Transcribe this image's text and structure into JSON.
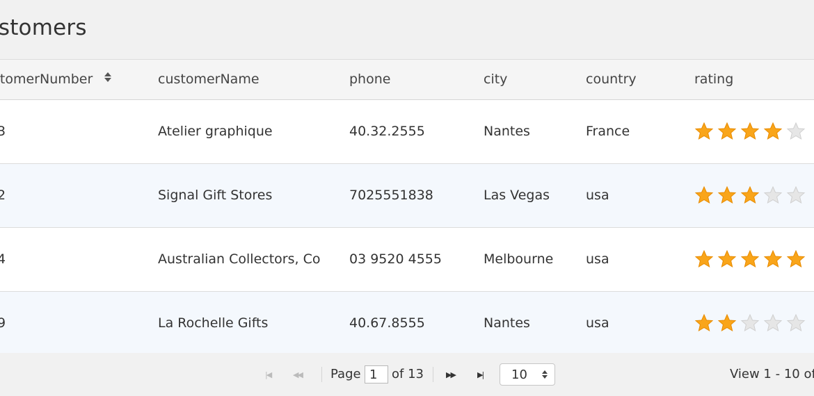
{
  "title": "ustomers",
  "columns": [
    {
      "label": "stomerNumber",
      "sortable": true
    },
    {
      "label": "customerName"
    },
    {
      "label": "phone"
    },
    {
      "label": "city"
    },
    {
      "label": "country"
    },
    {
      "label": "rating"
    }
  ],
  "rows": [
    {
      "number": "3",
      "name": "Atelier graphique",
      "phone": "40.32.2555",
      "city": "Nantes",
      "country": "France",
      "rating": 4
    },
    {
      "number": "2",
      "name": "Signal Gift Stores",
      "phone": "7025551838",
      "city": "Las Vegas",
      "country": "usa",
      "rating": 3
    },
    {
      "number": "4",
      "name": "Australian Collectors, Co",
      "phone": "03 9520 4555",
      "city": "Melbourne",
      "country": "usa",
      "rating": 5
    },
    {
      "number": "9",
      "name": "La Rochelle Gifts",
      "phone": "40.67.8555",
      "city": "Nantes",
      "country": "usa",
      "rating": 2
    }
  ],
  "pager": {
    "page_label": "Page",
    "current_page": "1",
    "of_label": "of 13",
    "page_size": "10",
    "view_text": "View 1 - 10 of"
  },
  "colors": {
    "star_filled": "#f9a51a",
    "star_empty": "#e6e6e6",
    "row_alt": "#f4f8fd"
  },
  "icons": {
    "sort": "sort-both-icon",
    "first": "first-page-icon",
    "prev": "prev-page-icon",
    "next": "next-page-icon",
    "last": "last-page-icon",
    "star": "star-icon"
  }
}
